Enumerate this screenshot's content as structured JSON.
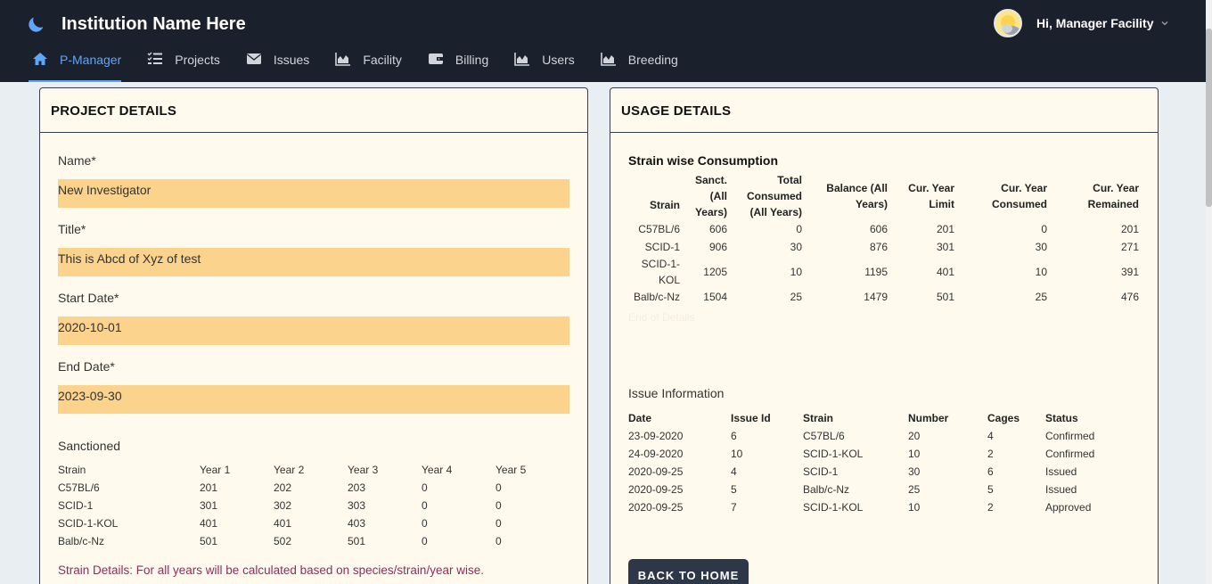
{
  "header": {
    "brand": "Institution Name Here",
    "greeting": "Hi, Manager Facility",
    "nav": [
      {
        "label": "P-Manager",
        "icon": "home-icon",
        "active": true
      },
      {
        "label": "Projects",
        "icon": "list-check-icon"
      },
      {
        "label": "Issues",
        "icon": "envelope-icon"
      },
      {
        "label": "Facility",
        "icon": "area-chart-icon"
      },
      {
        "label": "Billing",
        "icon": "wallet-icon"
      },
      {
        "label": "Users",
        "icon": "area-chart-icon"
      },
      {
        "label": "Breeding",
        "icon": "area-chart-icon"
      }
    ]
  },
  "project": {
    "heading": "PROJECT DETAILS",
    "fields": [
      {
        "label": "Name*",
        "value": "New Investigator"
      },
      {
        "label": "Title*",
        "value": "This is Abcd of Xyz of test"
      },
      {
        "label": "Start Date*",
        "value": "2020-10-01"
      },
      {
        "label": "End Date*",
        "value": "2023-09-30"
      }
    ],
    "sanctioned_title": "Sanctioned",
    "sanctioned_headers": [
      "Strain",
      "Year 1",
      "Year 2",
      "Year 3",
      "Year 4",
      "Year 5"
    ],
    "sanctioned_rows": [
      [
        "C57BL/6",
        "201",
        "202",
        "203",
        "0",
        "0"
      ],
      [
        "SCID-1",
        "301",
        "302",
        "303",
        "0",
        "0"
      ],
      [
        "SCID-1-KOL",
        "401",
        "401",
        "403",
        "0",
        "0"
      ],
      [
        "Balb/c-Nz",
        "501",
        "502",
        "501",
        "0",
        "0"
      ]
    ],
    "note": "Strain Details: For all years will be calculated based on species/strain/year wise."
  },
  "usage": {
    "heading": "USAGE DETAILS",
    "consumption_title": "Strain wise Consumption",
    "consumption_headers": [
      "Strain",
      "Sanct. (All Years)",
      "Total Consumed (All Years)",
      "Balance (All Years)",
      "Cur. Year Limit",
      "Cur. Year Consumed",
      "Cur. Year Remained"
    ],
    "consumption_rows": [
      [
        "C57BL/6",
        "606",
        "0",
        "606",
        "201",
        "0",
        "201"
      ],
      [
        "SCID-1",
        "906",
        "30",
        "876",
        "301",
        "30",
        "271"
      ],
      [
        "SCID-1-KOL",
        "1205",
        "10",
        "1195",
        "401",
        "10",
        "391"
      ],
      [
        "Balb/c-Nz",
        "1504",
        "25",
        "1479",
        "501",
        "25",
        "476"
      ]
    ],
    "end_note": "End of Details",
    "issue_title": "Issue Information",
    "issue_headers": [
      "Date",
      "Issue Id",
      "Strain",
      "Number",
      "Cages",
      "Status"
    ],
    "issue_rows": [
      [
        "23-09-2020",
        "6",
        "C57BL/6",
        "20",
        "4",
        "Confirmed"
      ],
      [
        "24-09-2020",
        "10",
        "SCID-1-KOL",
        "10",
        "2",
        "Confirmed"
      ],
      [
        "2020-09-25",
        "4",
        "SCID-1",
        "30",
        "6",
        "Issued"
      ],
      [
        "2020-09-25",
        "5",
        "Balb/c-Nz",
        "25",
        "5",
        "Issued"
      ],
      [
        "2020-09-25",
        "7",
        "SCID-1-KOL",
        "10",
        "2",
        "Approved"
      ]
    ],
    "back_button": "BACK TO HOME"
  }
}
